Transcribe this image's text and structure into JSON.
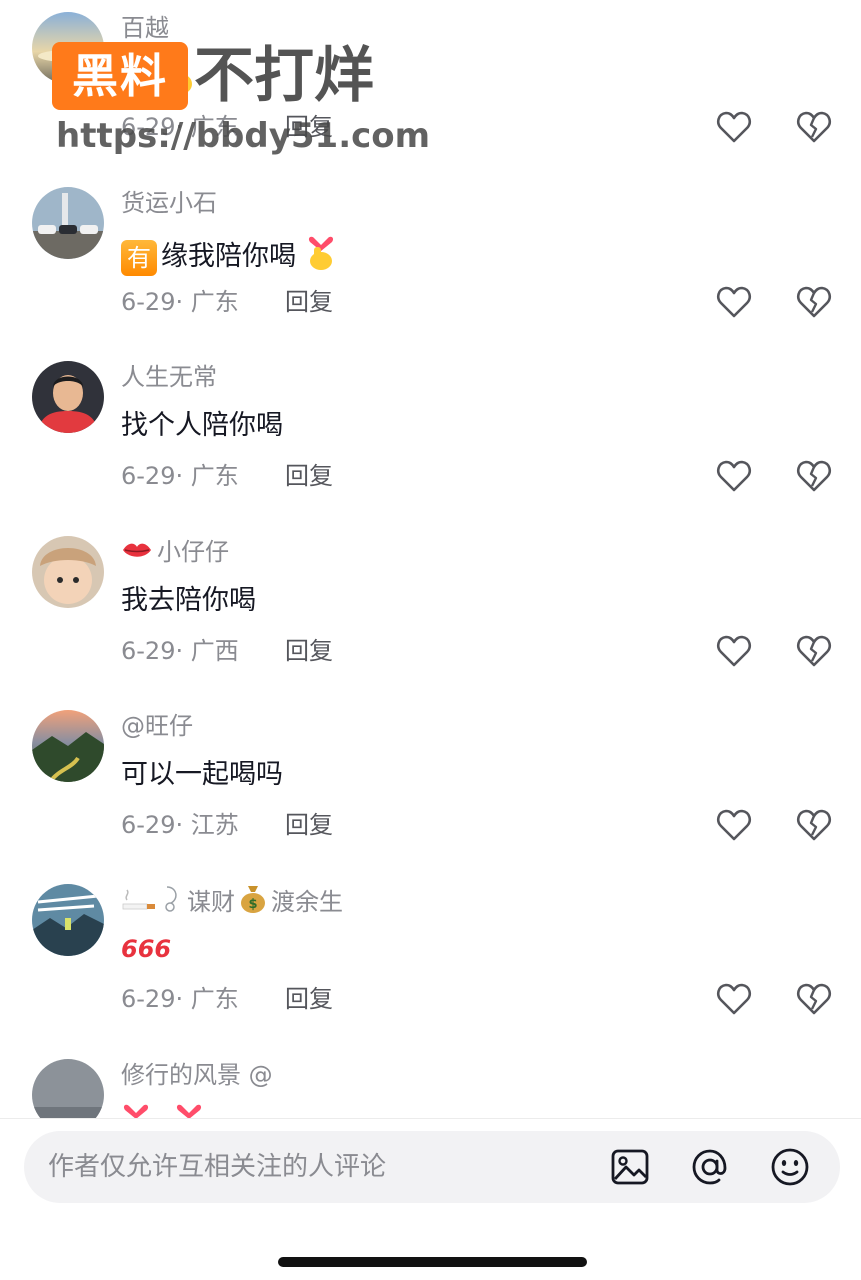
{
  "comments": [
    {
      "username": "百越",
      "text": "",
      "date": "6-29",
      "location": "广东",
      "reply_label": "回复"
    },
    {
      "username": "货运小石",
      "badge": "有",
      "text": "缘我陪你喝",
      "date": "6-29",
      "location": "广东",
      "reply_label": "回复"
    },
    {
      "username": "人生无常",
      "text": "找个人陪你喝",
      "date": "6-29",
      "location": "广东",
      "reply_label": "回复"
    },
    {
      "username": "小仔仔",
      "text": "我去陪你喝",
      "date": "6-29",
      "location": "广西",
      "reply_label": "回复"
    },
    {
      "username": "@旺仔",
      "text": "可以一起喝吗",
      "date": "6-29",
      "location": "江苏",
      "reply_label": "回复"
    },
    {
      "username_mid": "谋财",
      "username_end": "渡余生",
      "text": "666",
      "date": "6-29",
      "location": "广东",
      "reply_label": "回复"
    },
    {
      "username": "修行的风景 @"
    }
  ],
  "watermark": {
    "brand": "黑料",
    "slogan": "不打烊",
    "url": "https://bbdy51.com"
  },
  "input": {
    "placeholder": "作者仅允许互相关注的人评论"
  },
  "icons": {
    "like": "heart-outline-icon",
    "dislike": "broken-heart-icon",
    "image": "image-icon",
    "mention": "at-icon",
    "emoji": "emoji-icon"
  },
  "colors": {
    "secondary_text": "#8a8b91",
    "watermark_orange": "#ff7a1a"
  }
}
